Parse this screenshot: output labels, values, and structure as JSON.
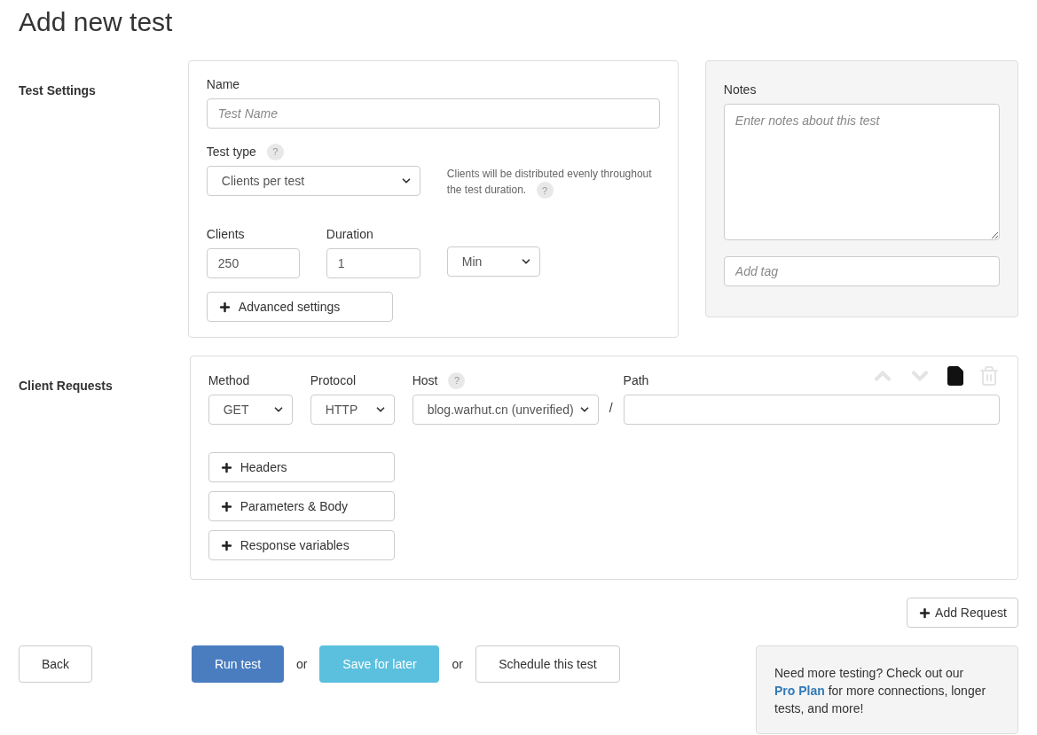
{
  "title": "Add new test",
  "test_settings": {
    "label": "Test Settings",
    "name": {
      "label": "Name",
      "placeholder": "Test Name"
    },
    "test_type": {
      "label": "Test type",
      "help": "?",
      "value": "Clients per test",
      "hint": "Clients will be distributed evenly throughout the test duration.",
      "hint_help": "?"
    },
    "clients": {
      "label": "Clients",
      "value": "250"
    },
    "duration": {
      "label": "Duration",
      "value": "1",
      "unit": "Min"
    },
    "advanced_button": "Advanced settings"
  },
  "notes": {
    "label": "Notes",
    "placeholder": "Enter notes about this test",
    "tag_placeholder": "Add tag"
  },
  "client_requests": {
    "label": "Client Requests",
    "method": {
      "label": "Method",
      "value": "GET"
    },
    "protocol": {
      "label": "Protocol",
      "value": "HTTP"
    },
    "host": {
      "label": "Host",
      "help": "?",
      "value": "blog.warhut.cn (unverified)"
    },
    "separator": "/",
    "path": {
      "label": "Path"
    },
    "actions": [
      {
        "kind": "up",
        "disabled": true
      },
      {
        "kind": "down",
        "disabled": true
      },
      {
        "kind": "copy",
        "disabled": false
      },
      {
        "kind": "delete",
        "disabled": true
      }
    ],
    "sections": [
      "Headers",
      "Parameters & Body",
      "Response variables"
    ],
    "add_request": "Add Request"
  },
  "footer": {
    "back": "Back",
    "run": "Run test",
    "or_1": "or",
    "save": "Save for later",
    "or_2": "or",
    "schedule": "Schedule this test",
    "promo": {
      "before": "Need more testing? Check out our",
      "link": "Pro Plan",
      "after": "for more connections, longer tests, and more!"
    }
  }
}
